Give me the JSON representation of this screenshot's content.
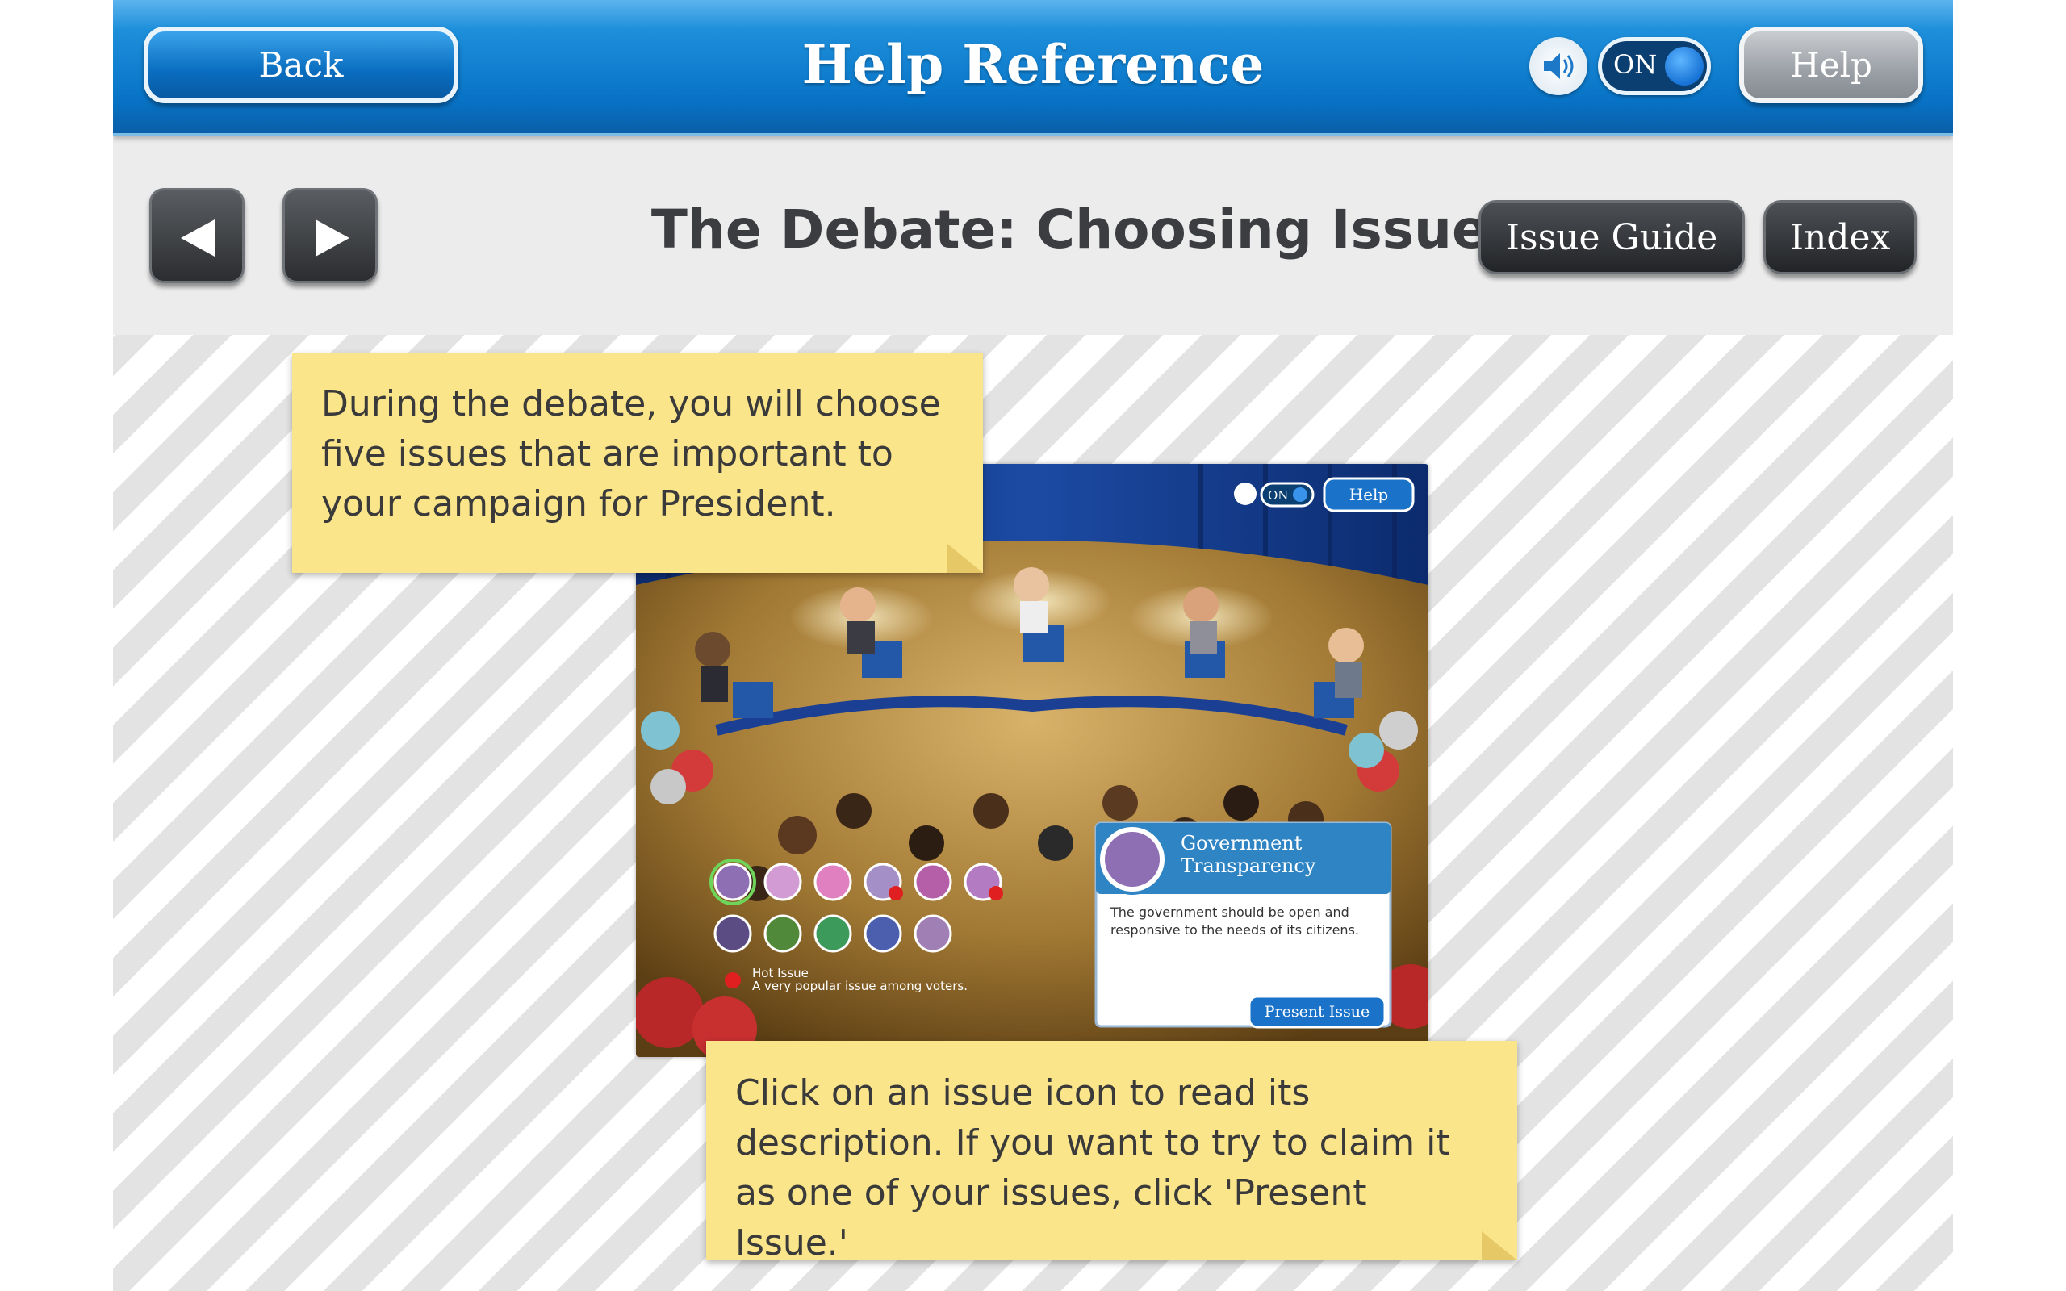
{
  "topbar": {
    "back_label": "Back",
    "title": "Help Reference",
    "sound_toggle_label": "ON",
    "help_label": "Help"
  },
  "header": {
    "page_title": "The Debate: Choosing Issues",
    "issue_guide_label": "Issue Guide",
    "index_label": "Index"
  },
  "notes": {
    "intro": "During the debate, you will choose five issues that are important to your campaign for President.",
    "instruction": "Click on an issue icon to read its description. If you want to try to claim it as one of your issues, click 'Present Issue.'"
  },
  "screenshot": {
    "toggle_label": "ON",
    "help_label": "Help",
    "issue_title_line1": "Government",
    "issue_title_line2": "Transparency",
    "issue_desc_line1": "The government should be open and",
    "issue_desc_line2": "responsive to the needs of its citizens.",
    "present_label": "Present Issue",
    "hot_issue_title": "Hot Issue",
    "hot_issue_desc": "A very popular issue among voters."
  },
  "colors": {
    "topbar_blue": "#0873c6",
    "note_yellow": "#fbe58a",
    "dark_button": "#2b2d30"
  }
}
